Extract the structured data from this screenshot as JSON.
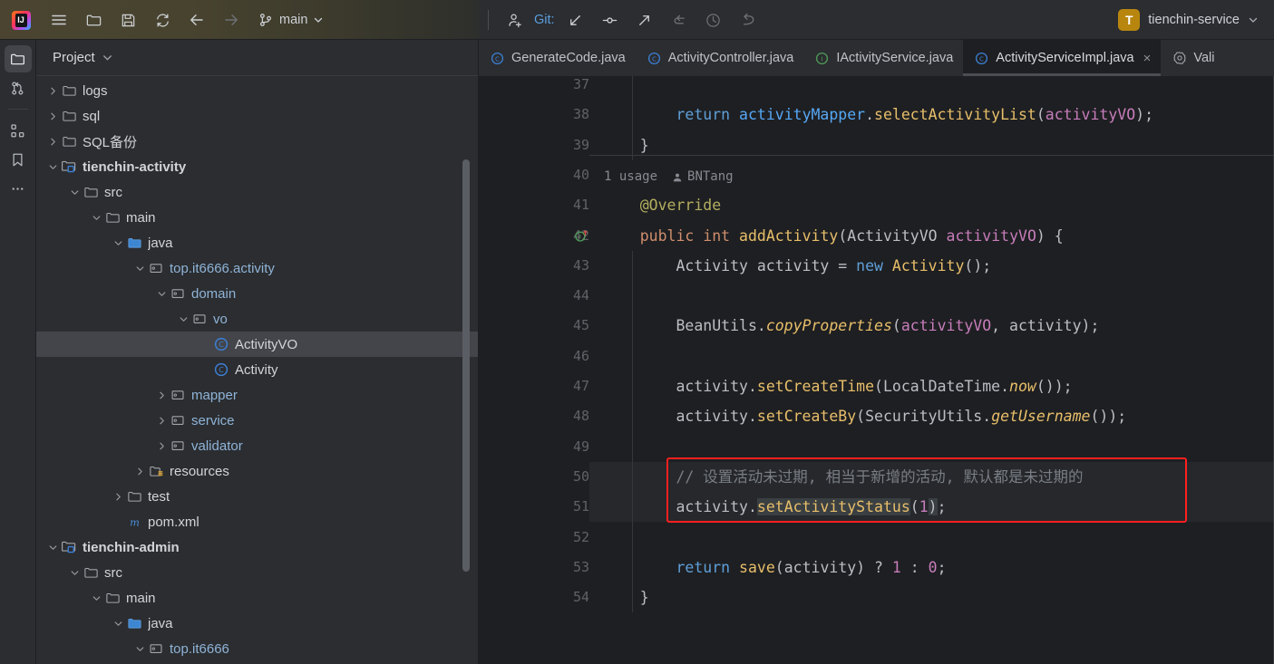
{
  "toolbar": {
    "logo_name": "intellij-idea-logo",
    "menu_icon": "hamburger-menu-icon",
    "open_icon": "folder-open-icon",
    "save_icon": "save-icon",
    "sync_icon": "refresh-sync-icon",
    "back_icon": "arrow-left-icon",
    "forward_icon": "arrow-right-icon",
    "branch_icon": "git-branch-icon",
    "branch_label": "main",
    "branch_chevron": "chevron-down-icon",
    "add_user_icon": "add-user-icon",
    "git_label": "Git:",
    "update_icon": "update-project-icon",
    "commit_icon": "commit-icon",
    "push_icon": "push-icon",
    "pull_icon": "pull-icon",
    "history_icon": "history-clock-icon",
    "rollback_icon": "rollback-icon",
    "project_initial": "T",
    "project_name": "tienchin-service",
    "project_chevron": "chevron-down-icon"
  },
  "rail": {
    "items": [
      {
        "name": "project-tool-icon",
        "active": true
      },
      {
        "name": "commit-tool-icon",
        "active": false
      },
      {
        "name": "structure-tool-icon",
        "active": false
      },
      {
        "name": "bookmarks-tool-icon",
        "active": false
      },
      {
        "name": "more-tool-icon",
        "active": false
      }
    ]
  },
  "project_panel": {
    "title": "Project",
    "chevron": "chevron-down-icon",
    "tree": [
      {
        "label": "logs",
        "indent": 1,
        "arrow": "right",
        "icon": "folder",
        "style": "plain"
      },
      {
        "label": "sql",
        "indent": 1,
        "arrow": "right",
        "icon": "folder",
        "style": "plain"
      },
      {
        "label": "SQL备份",
        "indent": 1,
        "arrow": "right",
        "icon": "folder",
        "style": "plain"
      },
      {
        "label": "tienchin-activity",
        "indent": 1,
        "arrow": "down",
        "icon": "module",
        "style": "bold"
      },
      {
        "label": "src",
        "indent": 2,
        "arrow": "down",
        "icon": "folder",
        "style": "plain"
      },
      {
        "label": "main",
        "indent": 3,
        "arrow": "down",
        "icon": "folder",
        "style": "plain"
      },
      {
        "label": "java",
        "indent": 4,
        "arrow": "down",
        "icon": "source-folder",
        "style": "plain"
      },
      {
        "label": "top.it6666.activity",
        "indent": 5,
        "arrow": "down",
        "icon": "package",
        "style": "plain"
      },
      {
        "label": "domain",
        "indent": 6,
        "arrow": "down",
        "icon": "package",
        "style": "plain"
      },
      {
        "label": "vo",
        "indent": 7,
        "arrow": "down",
        "icon": "package",
        "style": "plain"
      },
      {
        "label": "ActivityVO",
        "indent": 8,
        "arrow": "none",
        "icon": "java-class",
        "style": "plain",
        "selected": true
      },
      {
        "label": "Activity",
        "indent": 8,
        "arrow": "none",
        "icon": "java-class",
        "style": "plain"
      },
      {
        "label": "mapper",
        "indent": 6,
        "arrow": "right",
        "icon": "package",
        "style": "plain"
      },
      {
        "label": "service",
        "indent": 6,
        "arrow": "right",
        "icon": "package",
        "style": "plain"
      },
      {
        "label": "validator",
        "indent": 6,
        "arrow": "right",
        "icon": "package",
        "style": "plain"
      },
      {
        "label": "resources",
        "indent": 5,
        "arrow": "right",
        "icon": "resource-folder",
        "style": "plain"
      },
      {
        "label": "test",
        "indent": 4,
        "arrow": "right",
        "icon": "folder",
        "style": "plain"
      },
      {
        "label": "pom.xml",
        "indent": 4,
        "arrow": "none",
        "icon": "maven",
        "style": "plain"
      },
      {
        "label": "tienchin-admin",
        "indent": 1,
        "arrow": "down",
        "icon": "module",
        "style": "bold"
      },
      {
        "label": "src",
        "indent": 2,
        "arrow": "down",
        "icon": "folder",
        "style": "plain"
      },
      {
        "label": "main",
        "indent": 3,
        "arrow": "down",
        "icon": "folder",
        "style": "plain"
      },
      {
        "label": "java",
        "indent": 4,
        "arrow": "down",
        "icon": "source-folder",
        "style": "plain"
      },
      {
        "label": "top.it6666",
        "indent": 5,
        "arrow": "down",
        "icon": "package",
        "style": "plain"
      }
    ]
  },
  "tabs": [
    {
      "label": "GenerateCode.java",
      "icon": "java-class-icon",
      "active": false,
      "closable": false
    },
    {
      "label": "ActivityController.java",
      "icon": "java-class-icon",
      "active": false,
      "closable": false
    },
    {
      "label": "IActivityService.java",
      "icon": "java-interface-icon",
      "active": false,
      "closable": false
    },
    {
      "label": "ActivityServiceImpl.java",
      "icon": "java-class-icon",
      "active": true,
      "closable": true
    },
    {
      "label": "Vali",
      "icon": "settings-gear-icon",
      "active": false,
      "closable": false
    }
  ],
  "editor": {
    "usage_hint": "1 usage",
    "author": "BNTang",
    "author_icon": "person-icon",
    "bulb_icon": "intention-bulb-icon",
    "implements_icon": "implements-method-icon",
    "first_line_number": 37,
    "lines": [
      {
        "num": 37,
        "text": ""
      },
      {
        "num": 38,
        "text": "        return activityMapper.selectActivityList(activityVO);"
      },
      {
        "num": 39,
        "text": "    }"
      },
      {
        "num": 40,
        "text": ""
      },
      {
        "num": 41,
        "text": "    @Override"
      },
      {
        "num": 42,
        "text": "    public int addActivity(ActivityVO activityVO) {"
      },
      {
        "num": 43,
        "text": "        Activity activity = new Activity();"
      },
      {
        "num": 44,
        "text": ""
      },
      {
        "num": 45,
        "text": "        BeanUtils.copyProperties(activityVO, activity);"
      },
      {
        "num": 46,
        "text": ""
      },
      {
        "num": 47,
        "text": "        activity.setCreateTime(LocalDateTime.now());"
      },
      {
        "num": 48,
        "text": "        activity.setCreateBy(SecurityUtils.getUsername());"
      },
      {
        "num": 49,
        "text": ""
      },
      {
        "num": 50,
        "text": "        // 设置活动未过期, 相当于新增的活动, 默认都是未过期的"
      },
      {
        "num": 51,
        "text": "        activity.setActivityStatus(1);"
      },
      {
        "num": 52,
        "text": ""
      },
      {
        "num": 53,
        "text": "        return save(activity) ? 1 : 0;"
      },
      {
        "num": 54,
        "text": "    }"
      }
    ],
    "highlight_comment": "// 设置活动未过期, 相当于新增的活动, 默认都是未过期的",
    "highlight_code": "activity.setActivityStatus(1);",
    "highlight_color": "#ff1f1f"
  },
  "colors": {
    "bg_editor": "#1e1f22",
    "bg_panel": "#2b2d30",
    "accent_orange": "#b8860f",
    "keyword": "#cf8e6d",
    "method": "#56a8f5",
    "function": "#e8bf6a",
    "param": "#c77dbb",
    "comment": "#7a7e85",
    "annotation": "#b3ae60"
  }
}
